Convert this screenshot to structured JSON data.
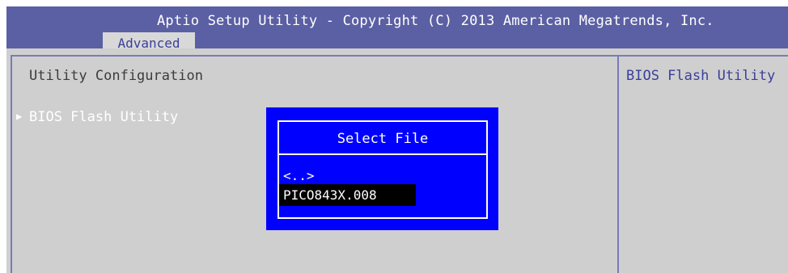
{
  "header": {
    "title": "Aptio Setup Utility - Copyright (C) 2013 American Megatrends, Inc.",
    "tabs": [
      {
        "label": "Advanced",
        "active": true
      }
    ]
  },
  "main": {
    "section_title": "Utility Configuration",
    "items": [
      {
        "label": "BIOS Flash Utility",
        "arrow": "▶"
      }
    ]
  },
  "help": {
    "text": "BIOS Flash Utility"
  },
  "dialog": {
    "title": "Select File",
    "files": [
      {
        "label": "<..>",
        "selected": false
      },
      {
        "label": "PICO843X.008",
        "selected": true
      }
    ]
  },
  "colors": {
    "header_bg": "#5b5fa3",
    "content_bg": "#cfcfcf",
    "dialog_bg": "#0000ff",
    "selection_bg": "#000000",
    "tab_text": "#3a3f9a"
  }
}
